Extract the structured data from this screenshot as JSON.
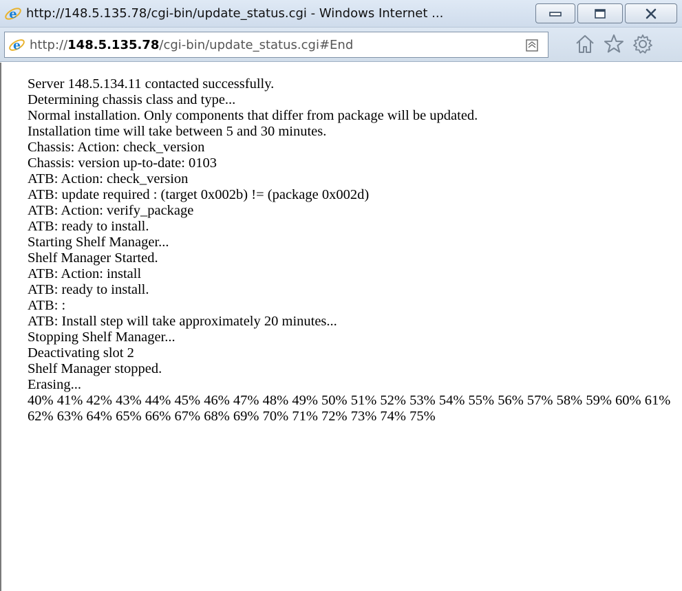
{
  "window": {
    "title": "http://148.5.135.78/cgi-bin/update_status.cgi - Windows Internet ...",
    "icon": "ie-icon",
    "controls": [
      "minimize-icon",
      "maximize-icon",
      "close-icon"
    ]
  },
  "address_bar": {
    "url_prefix": "http://",
    "url_host": "148.5.135.78",
    "url_path": "/cgi-bin/update_status.cgi#End",
    "compat_icon": "compatibility-view-icon"
  },
  "toolbar": {
    "icons": [
      "home-icon",
      "favorites-star-icon",
      "tools-gear-icon"
    ]
  },
  "log": [
    "Server 148.5.134.11 contacted successfully.",
    "Determining chassis class and type...",
    "Normal installation. Only components that differ from package will be updated.",
    "Installation time will take between 5 and 30 minutes.",
    "Chassis: Action: check_version",
    "Chassis: version up-to-date: 0103",
    "ATB: Action: check_version",
    "ATB: update required : (target 0x002b) != (package 0x002d)",
    "ATB: Action: verify_package",
    "ATB: ready to install.",
    "Starting Shelf Manager...",
    "Shelf Manager Started.",
    "ATB: Action: install",
    "ATB: ready to install.",
    "ATB: :",
    "ATB: Install step will take approximately 20 minutes...",
    "Stopping Shelf Manager...",
    "Deactivating slot 2",
    "Shelf Manager stopped.",
    "Erasing..."
  ],
  "progress_text": "40% 41% 42% 43% 44% 45% 46% 47% 48% 49% 50% 51% 52% 53% 54% 55% 56% 57% 58% 59% 60% 61% 62% 63% 64% 65% 66% 67% 68% 69% 70% 71% 72% 73% 74% 75%"
}
